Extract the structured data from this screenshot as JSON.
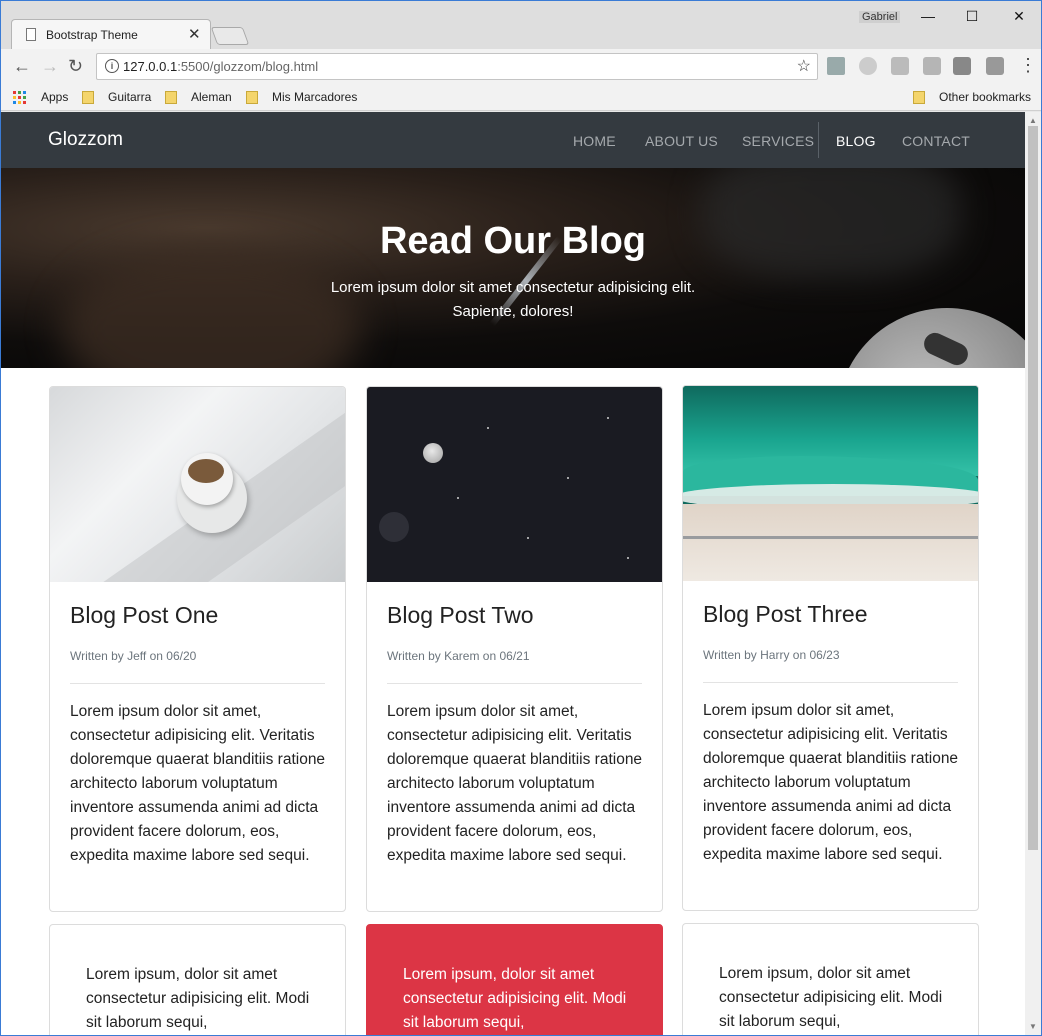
{
  "browser": {
    "tab_title": "Bootstrap Theme",
    "profile_name": "Gabriel",
    "url_host": "127.0.0.1",
    "url_path": ":5500/glozzom/blog.html",
    "bookmarks": [
      "Apps",
      "Guitarra",
      "Aleman",
      "Mis Marcadores"
    ],
    "other_bookmarks": "Other bookmarks"
  },
  "nav": {
    "brand": "Glozzom",
    "links": [
      "HOME",
      "ABOUT US",
      "SERVICES",
      "BLOG",
      "CONTACT"
    ],
    "active": "BLOG"
  },
  "hero": {
    "title": "Read Our Blog",
    "subtitle": "Lorem ipsum dolor sit amet consectetur adipisicing elit. Sapiente, dolores!"
  },
  "posts": [
    {
      "title": "Blog Post One",
      "meta": "Written by Jeff on 06/20",
      "body": "Lorem ipsum dolor sit amet, consectetur adipisicing elit. Veritatis doloremque quaerat blanditiis ratione architecto laborum voluptatum inventore assumenda animi ad dicta provident facere dolorum, eos, expedita maxime labore sed sequi."
    },
    {
      "title": "Blog Post Two",
      "meta": "Written by Karem on 06/21",
      "body": "Lorem ipsum dolor sit amet, consectetur adipisicing elit. Veritatis doloremque quaerat blanditiis ratione architecto laborum voluptatum inventore assumenda animi ad dicta provident facere dolorum, eos, expedita maxime labore sed sequi."
    },
    {
      "title": "Blog Post Three",
      "meta": "Written by Harry on 06/23",
      "body": "Lorem ipsum dolor sit amet, consectetur adipisicing elit. Veritatis doloremque quaerat blanditiis ratione architecto laborum voluptatum inventore assumenda animi ad dicta provident facere dolorum, eos, expedita maxime labore sed sequi."
    }
  ],
  "quotes": [
    "Lorem ipsum, dolor sit amet consectetur adipisicing elit. Modi sit laborum sequi,",
    "Lorem ipsum, dolor sit amet consectetur adipisicing elit. Modi sit laborum sequi,",
    "Lorem ipsum, dolor sit amet consectetur adipisicing elit. Modi sit laborum sequi,"
  ],
  "colors": {
    "navbar": "#343a40",
    "danger": "#dc3545"
  }
}
